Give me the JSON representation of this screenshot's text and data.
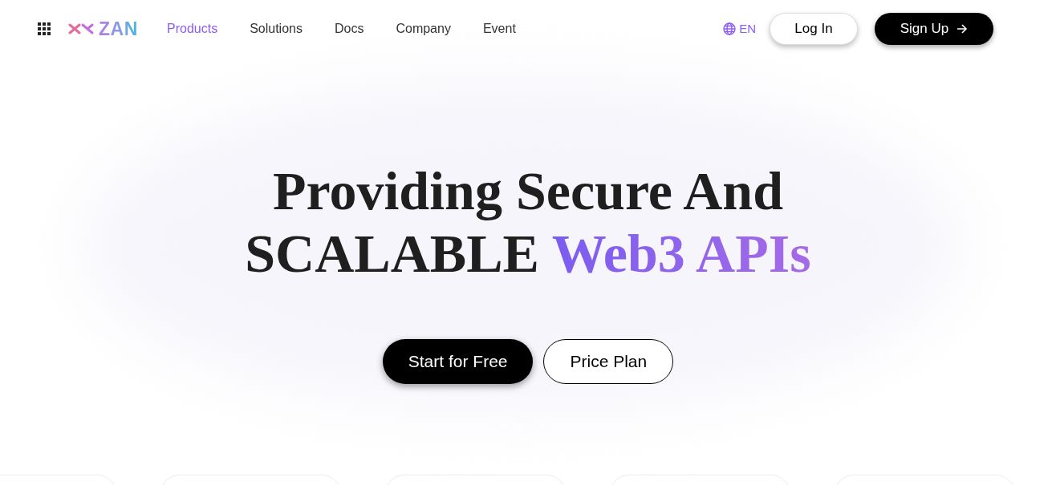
{
  "header": {
    "logo": "ZAN",
    "nav": [
      {
        "label": "Products",
        "selected": true
      },
      {
        "label": "Solutions",
        "selected": false
      },
      {
        "label": "Docs",
        "selected": false
      },
      {
        "label": "Company",
        "selected": false
      },
      {
        "label": "Event",
        "selected": false
      }
    ],
    "language": "EN",
    "buttons": [
      {
        "label": "Log In",
        "kind": "outline"
      },
      {
        "label": "Sign Up",
        "kind": "primary"
      }
    ]
  },
  "hero": {
    "title_lines": [
      [
        {
          "text": "Providing Secure And",
          "highlight": false
        }
      ],
      [
        {
          "text": "SCALABLE ",
          "highlight": false
        },
        {
          "text": "Web3 APIs",
          "highlight": true
        }
      ]
    ],
    "buttons": [
      {
        "label": "Start for Free",
        "kind": "primary"
      },
      {
        "label": "Price Plan",
        "kind": "outline"
      }
    ]
  }
}
